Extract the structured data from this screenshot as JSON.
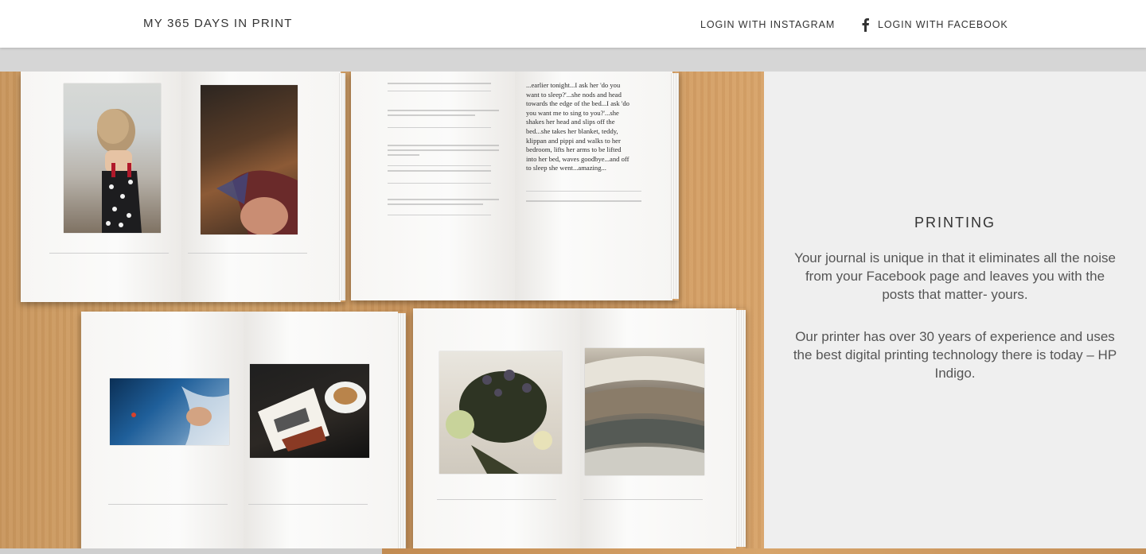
{
  "header": {
    "brand": "MY 365 DAYS IN PRINT",
    "login_instagram": "LOGIN WITH INSTAGRAM",
    "login_facebook": "LOGIN WITH FACEBOOK",
    "facebook_icon": "facebook-icon"
  },
  "section": {
    "title": "PRINTING",
    "paragraph_1": "Your journal is unique in that it eliminates all the noise from your Facebook page and leaves you with the posts that matter- yours.",
    "paragraph_2": "Our printer has over 30 years of experience and uses the best digital printing technology there is today – HP Indigo."
  },
  "photo": {
    "alt": "Open printed journal books on a wooden table",
    "journal_text_lines": [
      "...earlier tonight...I ask her 'do you",
      "want to sleep?'...she nods and head",
      "towards the edge of the bed...I ask 'do",
      "you want me to sing to you?'...she",
      "shakes her head and slips off the",
      "bed...she takes her blanket, teddy,",
      "klippan and pippi and walks to her",
      "bedroom, lifts her arms to be lifted",
      "into her bed, waves goodbye...and off",
      "to sleep she went...amazing..."
    ]
  },
  "colors": {
    "panel_bg": "#efefef",
    "band_grey": "#d6d6d6",
    "text_dark": "#333333",
    "text_body": "#555555"
  }
}
